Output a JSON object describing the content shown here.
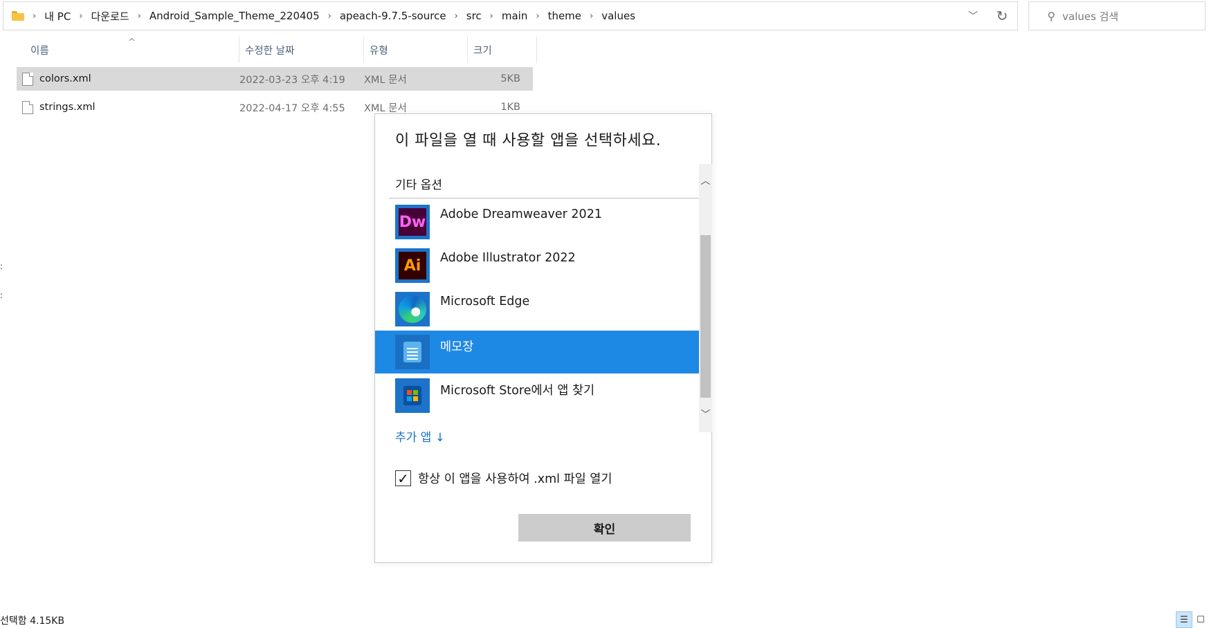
{
  "address_bar": {
    "crumbs": [
      "내 PC",
      "다운로드",
      "Android_Sample_Theme_220405",
      "apeach-9.7.5-source",
      "src",
      "main",
      "theme",
      "values"
    ]
  },
  "search": {
    "placeholder": "values 검색"
  },
  "columns": {
    "name": "이름",
    "modified": "수정한 날짜",
    "type": "유형",
    "size": "크기"
  },
  "files": [
    {
      "name": "colors.xml",
      "modified": "2022-03-23 오후 4:19",
      "type": "XML 문서",
      "size": "5KB",
      "selected": true
    },
    {
      "name": "strings.xml",
      "modified": "2022-04-17 오후 4:55",
      "type": "XML 문서",
      "size": "1KB",
      "selected": false
    }
  ],
  "status_bar": {
    "text": "선택함 4.15KB"
  },
  "dialog": {
    "title": "이 파일을 열 때 사용할 앱을 선택하세요.",
    "section": "기타 옵션",
    "apps": [
      {
        "name": "Adobe Dreamweaver 2021",
        "icon": "dreamweaver-icon",
        "icon_text": "Dw"
      },
      {
        "name": "Adobe Illustrator 2022",
        "icon": "illustrator-icon",
        "icon_text": "Ai"
      },
      {
        "name": "Microsoft Edge",
        "icon": "edge-icon"
      },
      {
        "name": "메모장",
        "icon": "notepad-icon",
        "selected": true
      },
      {
        "name": "Microsoft Store에서 앱 찾기",
        "icon": "store-icon"
      }
    ],
    "more_apps": "추가 앱 ↓",
    "always_use": {
      "label": "항상 이 앱을 사용하여 .xml 파일 열기",
      "checked": true
    },
    "ok_button": "확인"
  },
  "colors": {
    "selection": "#1e88e5",
    "link": "#1873c6",
    "row_selected": "#d9d9d9"
  }
}
